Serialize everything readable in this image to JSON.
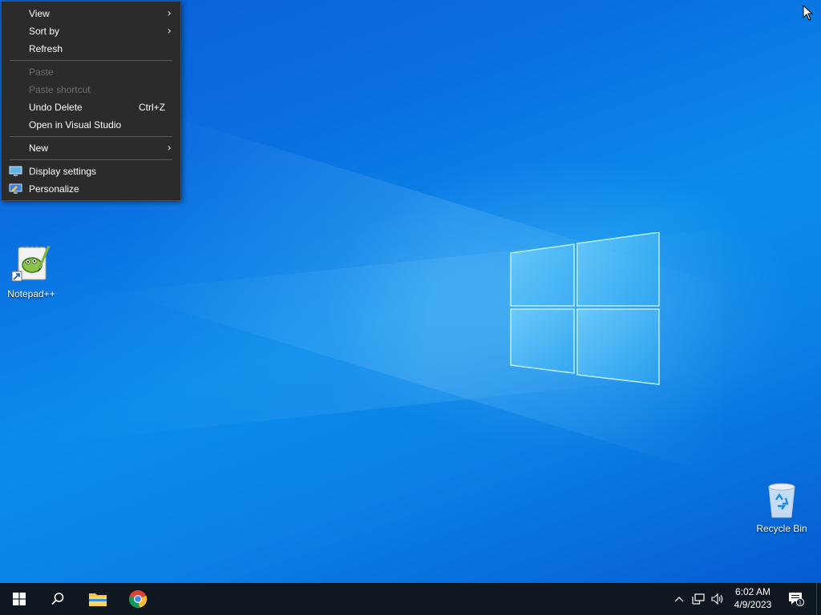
{
  "context_menu": {
    "items": [
      {
        "label": "View",
        "submenu": true
      },
      {
        "label": "Sort by",
        "submenu": true
      },
      {
        "label": "Refresh"
      },
      {
        "label": "Paste",
        "disabled": true
      },
      {
        "label": "Paste shortcut",
        "disabled": true
      },
      {
        "label": "Undo Delete",
        "shortcut": "Ctrl+Z"
      },
      {
        "label": "Open in Visual Studio"
      },
      {
        "label": "New",
        "submenu": true
      },
      {
        "label": "Display settings",
        "icon": "display-settings-icon"
      },
      {
        "label": "Personalize",
        "icon": "personalize-icon"
      }
    ]
  },
  "desktop": {
    "icons": [
      {
        "label": "Notepad++",
        "icon": "notepad-plus-plus-icon"
      },
      {
        "label": "Recycle Bin",
        "icon": "recycle-bin-icon"
      }
    ]
  },
  "taskbar": {
    "pinned": [
      "start-button",
      "search-icon",
      "file-explorer-icon",
      "chrome-icon"
    ],
    "tray": {
      "icons": [
        "chevron-up-icon",
        "network-icon",
        "volume-icon"
      ],
      "time": "6:02 AM",
      "date": "4/9/2023",
      "notification_count": "1"
    }
  },
  "colors": {
    "desktop_accent": "#0b8ceb",
    "menu_bg": "#2b2b2b",
    "taskbar_bg": "#0f1720"
  }
}
